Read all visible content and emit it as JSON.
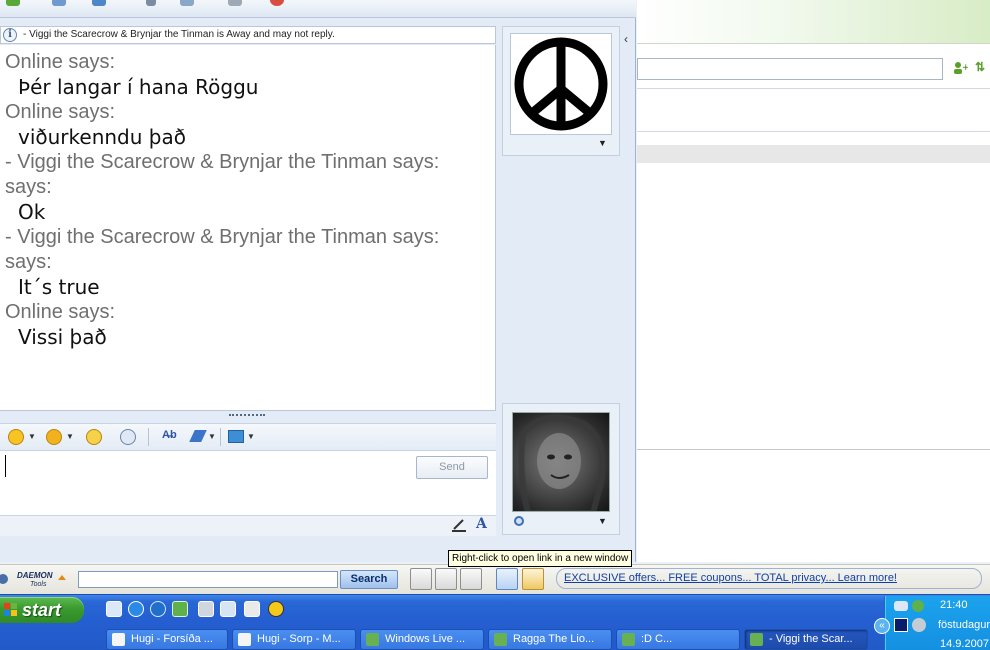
{
  "status": {
    "away_notice": "- Viggi the Scarecrow & Brynjar the Tinman is Away and may not reply."
  },
  "conversation": [
    {
      "sender": "Online says:",
      "message": "Þér langar í hana Röggu"
    },
    {
      "sender": "Online says:",
      "message": "viðurkenndu það"
    },
    {
      "sender": "- Viggi the Scarecrow & Brynjar the Tinman says:",
      "sender_cont": "says:",
      "message": "Ok"
    },
    {
      "sender": "- Viggi the Scarecrow & Brynjar the Tinman says:",
      "sender_cont": "says:",
      "message": "It´s true"
    },
    {
      "sender": "Online says:",
      "message": "Vissi það"
    }
  ],
  "compose": {
    "send_label": "Send"
  },
  "format_bar": {
    "font_label": "A"
  },
  "daemon_toolbar": {
    "logo_text": "DAEMON Tools",
    "search_label": "Search",
    "offers_link": "EXCLUSIVE offers... FREE coupons... TOTAL privacy... Learn more!"
  },
  "tooltip": "Right-click to open link in a new window",
  "taskbar": {
    "start_label": "start",
    "tasks": [
      {
        "label": "Hugi - Forsíða ..."
      },
      {
        "label": "Hugi - Sorp - M..."
      },
      {
        "label": "Windows Live ..."
      },
      {
        "label": "Ragga The Lio..."
      },
      {
        "label": ":D C..."
      },
      {
        "label": "- Viggi the Scar..."
      }
    ],
    "clock": "21:40",
    "day": "föstudagur",
    "date": "14.9.2007"
  },
  "colors": {
    "accent_blue": "#245ed0",
    "start_green": "#3a9a2f",
    "link_blue": "#0f3fa5"
  }
}
